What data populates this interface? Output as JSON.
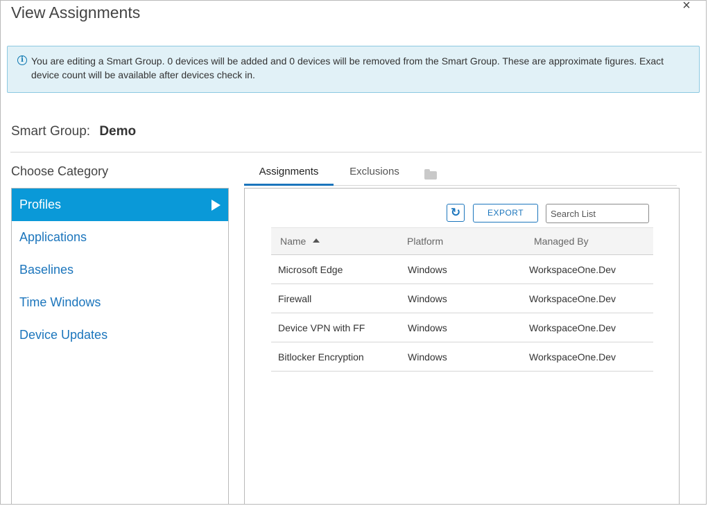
{
  "dialog": {
    "title": "View Assignments",
    "close_glyph": "×"
  },
  "banner": {
    "icon": "info-icon",
    "text": "You are editing a Smart Group. 0 devices will be added and 0 devices will be removed from the Smart Group. These are approximate figures. Exact device count will be available after devices check in."
  },
  "smart_group": {
    "label": "Smart Group:",
    "name": "Demo"
  },
  "category": {
    "heading": "Choose Category",
    "items": [
      {
        "label": "Profiles",
        "active": true
      },
      {
        "label": "Applications",
        "active": false
      },
      {
        "label": "Baselines",
        "active": false
      },
      {
        "label": "Time Windows",
        "active": false
      },
      {
        "label": "Device Updates",
        "active": false
      }
    ]
  },
  "tabs": [
    {
      "label": "Assignments",
      "active": true
    },
    {
      "label": "Exclusions",
      "active": false
    }
  ],
  "toolbar": {
    "refresh_icon": "refresh-icon",
    "export_label": "EXPORT",
    "search_placeholder": "Search List"
  },
  "table": {
    "columns": [
      "Name",
      "Platform",
      "Managed By"
    ],
    "sort": {
      "column": "Name",
      "direction": "ascending"
    },
    "rows": [
      {
        "name": "Microsoft Edge",
        "platform": "Windows",
        "managed_by": "WorkspaceOne.Dev"
      },
      {
        "name": "Firewall",
        "platform": "Windows",
        "managed_by": "WorkspaceOne.Dev"
      },
      {
        "name": "Device VPN with FF",
        "platform": "Windows",
        "managed_by": "WorkspaceOne.Dev"
      },
      {
        "name": "Bitlocker Encryption",
        "platform": "Windows",
        "managed_by": "WorkspaceOne.Dev"
      }
    ]
  },
  "colors": {
    "accent": "#1b75bc",
    "active_item": "#0a99d8",
    "banner_bg": "#e1f1f7",
    "banner_border": "#8cc8e1"
  }
}
